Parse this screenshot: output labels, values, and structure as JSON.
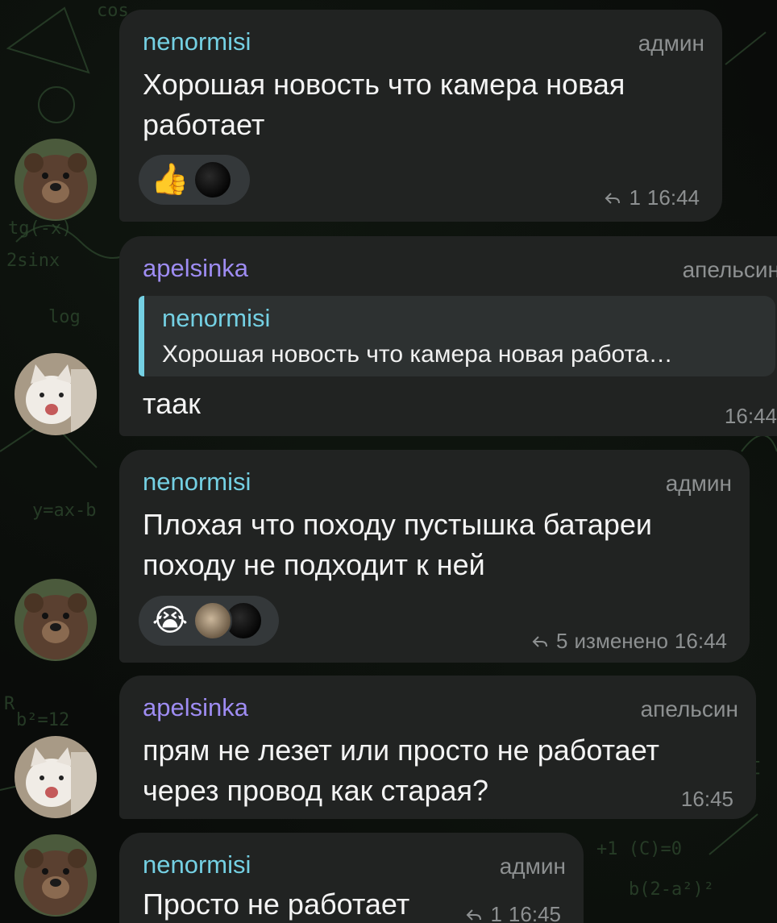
{
  "messages": [
    {
      "sender": "nenormisi",
      "role": "админ",
      "text": "Хорошая новость что камера новая\nработает",
      "reactions": [
        "👍"
      ],
      "replies": "1",
      "time": "16:44"
    },
    {
      "sender": "apelsinka",
      "role": "апельсин",
      "quote_name": "nenormisi",
      "quote_text": "Хорошая новость что камера новая работа…",
      "text": "таак",
      "time": "16:44"
    },
    {
      "sender": "nenormisi",
      "role": "админ",
      "text": "Плохая что походу пустышка батареи\nпоходу не подходит к ней",
      "reactions": [
        "😭"
      ],
      "replies": "5",
      "edited": "изменено",
      "time": "16:44"
    },
    {
      "sender": "apelsinka",
      "role": "апельсин",
      "text": "прям не лезет или просто не работает\nчерез провод как старая?",
      "time": "16:45"
    },
    {
      "sender": "nenormisi",
      "role": "админ",
      "text": "Просто не работает",
      "replies": "1",
      "time": "16:45"
    }
  ],
  "icons": {
    "reply": "reply-arrow-icon",
    "avatar_bear": "bear-avatar-icon",
    "avatar_cat": "cat-avatar-icon"
  },
  "colors": {
    "bubble": "#212322",
    "name_blue": "#74d0e3",
    "name_purple": "#9e8cf2",
    "meta_gray": "#8d9091"
  }
}
